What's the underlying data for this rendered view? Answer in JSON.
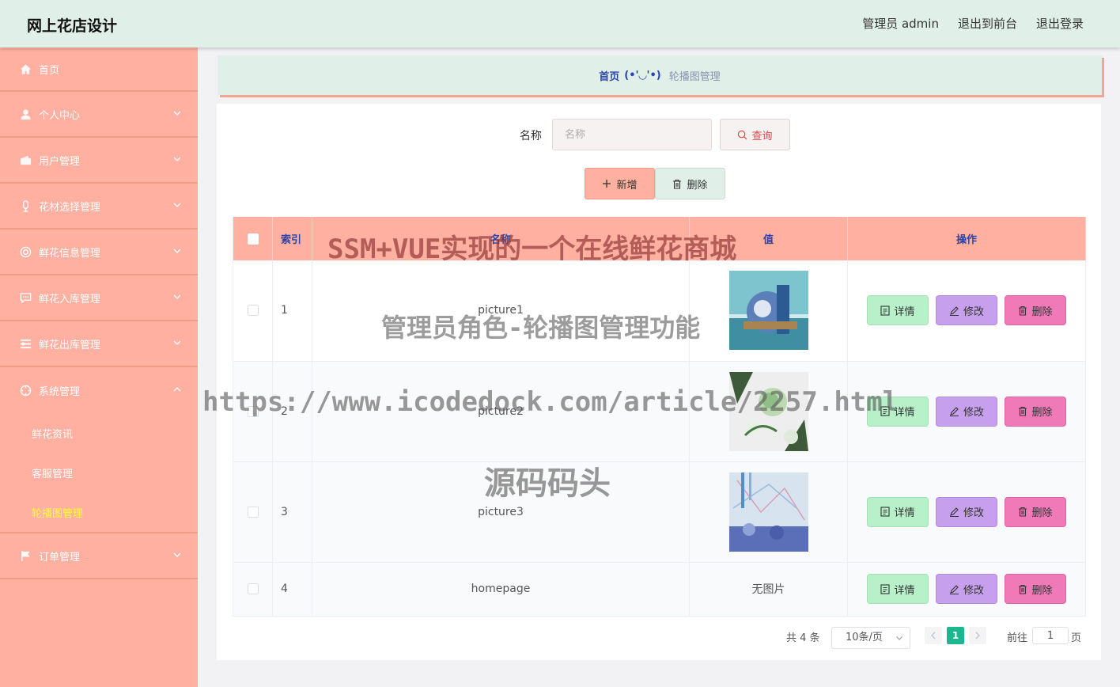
{
  "header": {
    "brand": "网上花店设计",
    "role_label": "管理员 admin",
    "to_front": "退出到前台",
    "logout": "退出登录"
  },
  "sidebar": {
    "items": [
      {
        "label": "首页",
        "icon": "home-icon"
      },
      {
        "label": "个人中心",
        "icon": "user-icon"
      },
      {
        "label": "用户管理",
        "icon": "wallet-icon"
      },
      {
        "label": "花材选择管理",
        "icon": "mic-icon"
      },
      {
        "label": "鲜花信息管理",
        "icon": "target-icon"
      },
      {
        "label": "鲜花入库管理",
        "icon": "chat-icon"
      },
      {
        "label": "鲜花出库管理",
        "icon": "list-icon"
      },
      {
        "label": "系统管理",
        "icon": "settings-icon"
      },
      {
        "label": "订单管理",
        "icon": "flag-icon"
      }
    ],
    "system_sub": [
      "鲜花资讯",
      "客服管理",
      "轮播图管理"
    ]
  },
  "breadcrumb": {
    "home": "首页",
    "sep": "(•'◡'•)",
    "current": "轮播图管理"
  },
  "search": {
    "label": "名称",
    "placeholder": "名称",
    "button": "查询"
  },
  "toolbar": {
    "add": "新增",
    "delete": "删除"
  },
  "table": {
    "headers": {
      "index": "索引",
      "name": "名称",
      "value": "值",
      "actions": "操作"
    },
    "rows": [
      {
        "index": "1",
        "name": "picture1",
        "value": ""
      },
      {
        "index": "2",
        "name": "picture2",
        "value": ""
      },
      {
        "index": "3",
        "name": "picture3",
        "value": ""
      },
      {
        "index": "4",
        "name": "homepage",
        "value": "无图片"
      }
    ],
    "actions": {
      "detail": "详情",
      "edit": "修改",
      "remove": "删除"
    }
  },
  "pagination": {
    "total": "共 4 条",
    "page_size": "10条/页",
    "current": "1",
    "goto_label": "前往",
    "goto_value": "1",
    "page_suffix": "页"
  },
  "watermarks": {
    "line1": "SSM+VUE实现的一个在线鲜花商城",
    "line2": "管理员角色-轮播图管理功能",
    "line3": "https://www.icodedock.com/article/2257.html",
    "line4": "源码码头"
  },
  "colors": {
    "header_bg": "#e0efe8",
    "sidebar_bg": "#ffb0a0",
    "active_sub": "#ffff33",
    "page_accent": "#1bb88f",
    "detail_btn": "#b7f0c9",
    "edit_btn": "#c6a0ec",
    "remove_btn": "#f07ab8"
  }
}
